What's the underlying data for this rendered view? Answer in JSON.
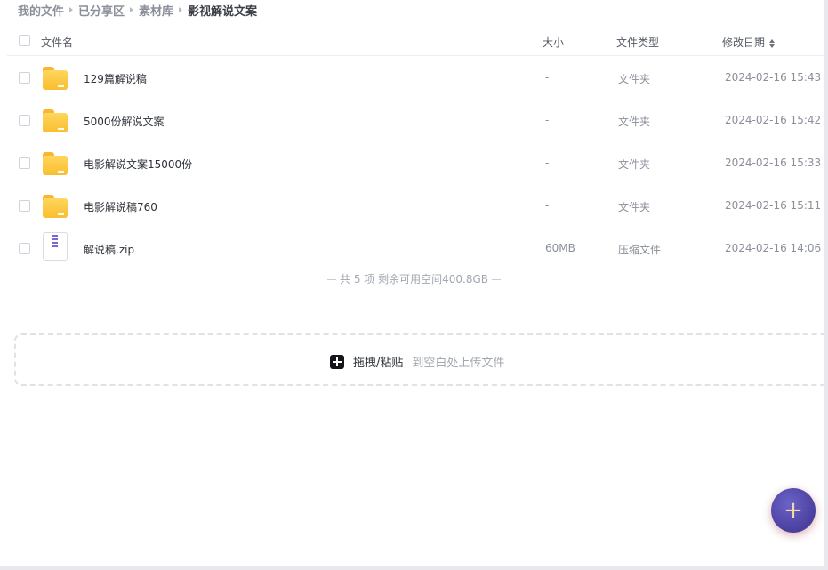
{
  "breadcrumb": [
    {
      "label": "我的文件"
    },
    {
      "label": "已分享区"
    },
    {
      "label": "素材库"
    },
    {
      "label": "影视解说文案"
    }
  ],
  "table": {
    "columns": {
      "name": "文件名",
      "size": "大小",
      "type": "文件类型",
      "modified": "修改日期"
    },
    "sort": {
      "column": "modified",
      "icon": "sort-icon"
    },
    "rows": [
      {
        "icon": "folder-icon",
        "name": "129篇解说稿",
        "size": "-",
        "type": "文件夹",
        "modified": "2024-02-16 15:43"
      },
      {
        "icon": "folder-icon",
        "name": "5000份解说文案",
        "size": "-",
        "type": "文件夹",
        "modified": "2024-02-16 15:42"
      },
      {
        "icon": "folder-icon",
        "name": "电影解说文案15000份",
        "size": "-",
        "type": "文件夹",
        "modified": "2024-02-16 15:33"
      },
      {
        "icon": "folder-icon",
        "name": "电影解说稿760",
        "size": "-",
        "type": "文件夹",
        "modified": "2024-02-16 15:11"
      },
      {
        "icon": "zip-file-icon",
        "name": "解说稿.zip",
        "size": "60MB",
        "type": "压缩文件",
        "modified": "2024-02-16 14:06"
      }
    ]
  },
  "summary": "共 5 项 剩余可用空间400.8GB",
  "dropzone": {
    "icon": "plus-square-icon",
    "main_label": "拖拽/粘贴",
    "sub_label": "到空白处上传文件"
  },
  "fab": {
    "icon": "plus-icon",
    "glyph": "+"
  },
  "colors": {
    "folder": "#f9be30",
    "accent": "#4b3f9e",
    "text_primary": "#2f333a",
    "text_secondary": "#8a8f99"
  }
}
